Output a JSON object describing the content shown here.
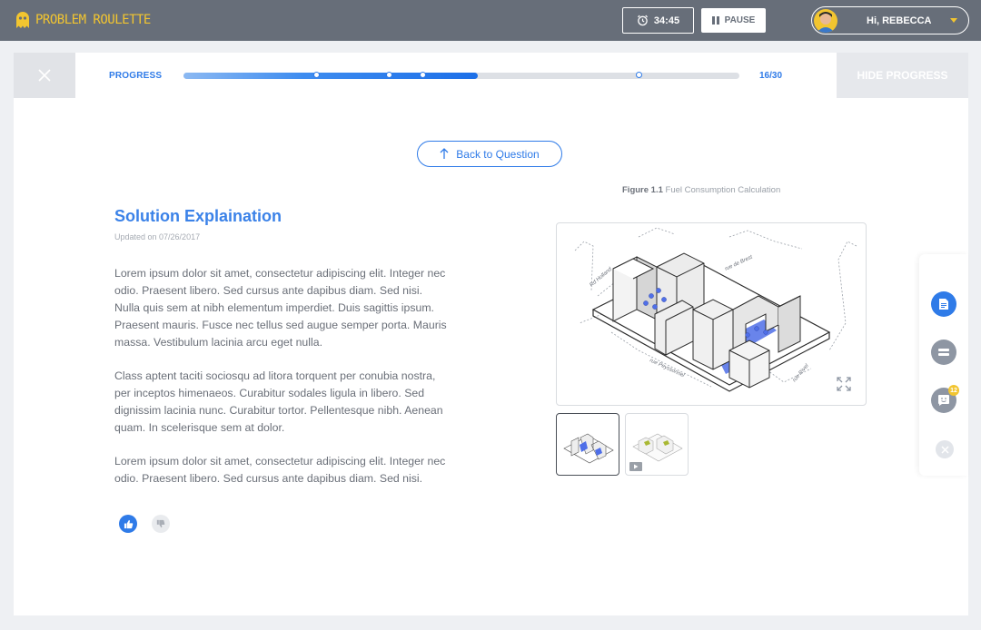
{
  "app": {
    "logo_text": "PROBLEM ROULETTE"
  },
  "header": {
    "timer": "34:45",
    "pause_label": "PAUSE",
    "greeting": "Hi, REBECCA"
  },
  "progress": {
    "label": "PROGRESS",
    "current": 16,
    "total": 30,
    "count_text": "16/30",
    "fill_fraction": 0.53,
    "markers": [
      0.24,
      0.37,
      0.43,
      0.82
    ],
    "hide_label": "HIDE PROGRESS"
  },
  "main": {
    "back_label": "Back to Question",
    "title": "Solution Explaination",
    "updated": "Updated on 07/26/2017",
    "paragraphs": [
      "Lorem ipsum dolor sit amet, consectetur adipiscing elit. Integer nec odio. Praesent libero. Sed cursus ante dapibus diam. Sed nisi. Nulla quis sem at nibh elementum imperdiet. Duis sagittis ipsum. Praesent mauris. Fusce nec tellus sed augue semper porta. Mauris massa. Vestibulum lacinia arcu eget nulla.",
      "Class aptent taciti sociosqu ad litora torquent per conubia nostra, per inceptos himenaeos. Curabitur sodales ligula in libero. Sed dignissim lacinia nunc. Curabitur tortor. Pellentesque nibh. Aenean quam. In scelerisque sem at dolor.",
      "Lorem ipsum dolor sit amet, consectetur adipiscing elit. Integer nec odio. Praesent libero. Sed cursus ante dapibus diam. Sed nisi."
    ]
  },
  "figure": {
    "number": "Figure 1.1",
    "caption": "Fuel Consumption Calculation",
    "street_labels": [
      "Rd Holland",
      "rue de Brest",
      "rue Rivel",
      "rue Peyssonnel"
    ]
  },
  "tools": {
    "chat_badge": "12"
  },
  "colors": {
    "accent": "#2f7be8",
    "topbar": "#676e79",
    "logo": "#f2c530",
    "highlight": "#3b5bdb"
  }
}
